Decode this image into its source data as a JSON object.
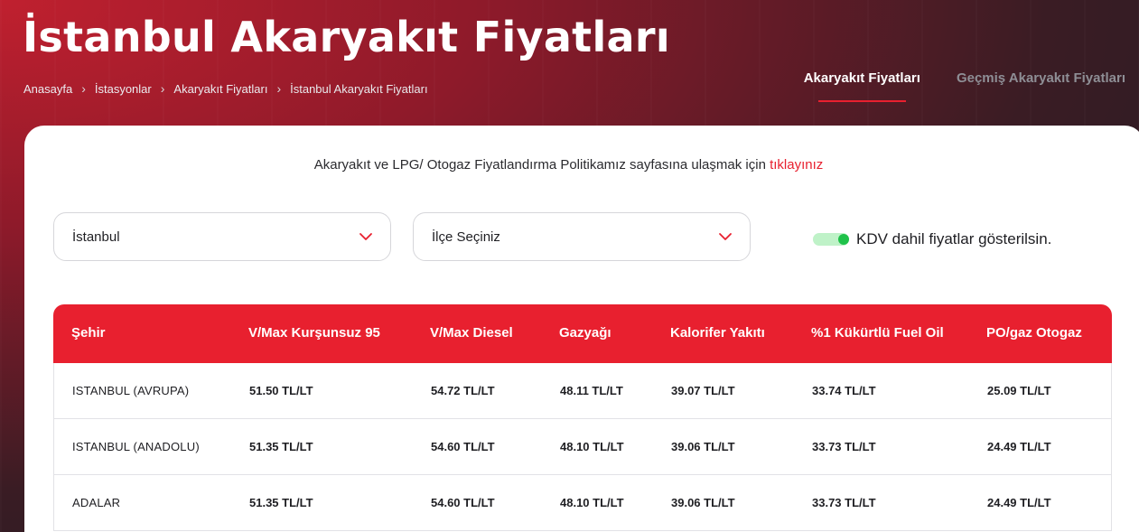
{
  "header": {
    "title": "İstanbul Akaryakıt Fiyatları",
    "breadcrumb": [
      "Anasayfa",
      "İstasyonlar",
      "Akaryakıt Fiyatları",
      "İstanbul Akaryakıt Fiyatları"
    ],
    "breadcrumb_separator": "›",
    "tabs": [
      {
        "label": "Akaryakıt Fiyatları",
        "active": true
      },
      {
        "label": "Geçmiş Akaryakıt Fiyatları",
        "active": false
      }
    ]
  },
  "notice": {
    "text": "Akaryakıt ve LPG/ Otogaz Fiyatlandırma Politikamız sayfasına ulaşmak için ",
    "link_label": "tıklayınız"
  },
  "filters": {
    "city_value": "İstanbul",
    "district_placeholder": "İlçe Seçiniz",
    "vat_toggle_label": "KDV dahil fiyatlar gösterilsin.",
    "vat_toggle_on": true
  },
  "table": {
    "columns": [
      "Şehir",
      "V/Max Kurşunsuz 95",
      "V/Max Diesel",
      "Gazyağı",
      "Kalorifer Yakıtı",
      "%1 Kükürtlü Fuel Oil",
      "PO/gaz Otogaz"
    ],
    "rows": [
      [
        "ISTANBUL (AVRUPA)",
        "51.50 TL/LT",
        "54.72 TL/LT",
        "48.11 TL/LT",
        "39.07 TL/LT",
        "33.74 TL/LT",
        "25.09 TL/LT"
      ],
      [
        "ISTANBUL (ANADOLU)",
        "51.35 TL/LT",
        "54.60 TL/LT",
        "48.10 TL/LT",
        "39.06 TL/LT",
        "33.73 TL/LT",
        "24.49 TL/LT"
      ],
      [
        "ADALAR",
        "51.35 TL/LT",
        "54.60 TL/LT",
        "48.10 TL/LT",
        "39.06 TL/LT",
        "33.73 TL/LT",
        "24.49 TL/LT"
      ]
    ]
  },
  "colors": {
    "accent": "#e8202f",
    "toggle_on": "#1fc24a"
  }
}
